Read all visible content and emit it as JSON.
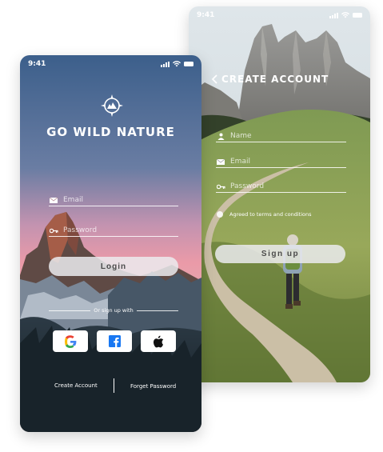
{
  "signup_screen": {
    "status_time": "9:41",
    "title": "CREATE ACCOUNT",
    "name_placeholder": "Name",
    "email_placeholder": "Email",
    "password_placeholder": "Password",
    "terms_label": "Agreed to terms and conditions",
    "signup_label": "Sign up"
  },
  "login_screen": {
    "status_time": "9:41",
    "app_title": "GO WILD NATURE",
    "email_placeholder": "Email",
    "password_placeholder": "Password",
    "login_label": "Login",
    "divider_text": "Or sign up with",
    "social": [
      "google",
      "facebook",
      "apple"
    ],
    "create_account_label": "Create Account",
    "forget_password_label": "Forget Password"
  },
  "colors": {
    "sky_top": "#4d6f97",
    "sky_pink": "#e99aa8",
    "facebook_blue": "#1877f2",
    "google_red": "#ea4335",
    "google_blue": "#4285f4",
    "google_green": "#34a853",
    "google_yellow": "#fbbc05"
  }
}
